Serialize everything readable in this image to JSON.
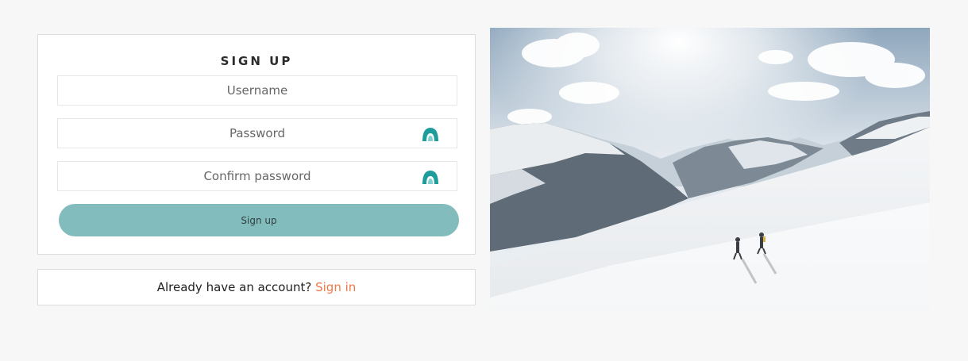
{
  "signup": {
    "title": "SIGN UP",
    "username_placeholder": "Username",
    "password_placeholder": "Password",
    "confirm_placeholder": "Confirm password",
    "submit_label": "Sign up"
  },
  "signin": {
    "prompt": "Already have an account?",
    "link_label": "Sign in"
  },
  "icons": {
    "password_toggle": "eye-icon",
    "confirm_toggle": "eye-icon"
  },
  "colors": {
    "accent_teal": "#83bcbd",
    "icon_teal": "#1f9c9c",
    "link_orange": "#f0784a",
    "background": "#f7f7f7"
  }
}
